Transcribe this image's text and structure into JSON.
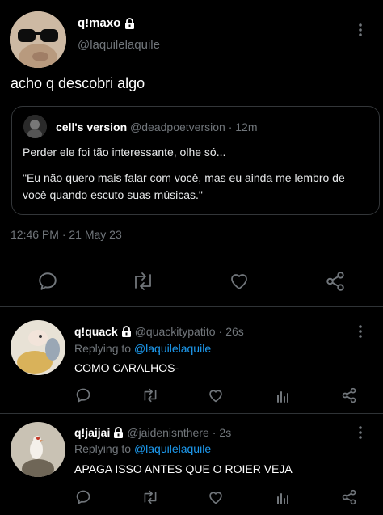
{
  "main_tweet": {
    "display_name": "q!maxo",
    "handle": "@laquilelaquile",
    "text": "acho q descobri algo",
    "quote": {
      "display_name": "cell's version",
      "handle": "@deadpoetversion",
      "sep": "·",
      "time": "12m",
      "line1": "Perder ele foi tão interessante, olhe só...",
      "line2": "\"Eu não quero mais falar com você, mas eu ainda me lembro de",
      "line3": "você quando escuto suas músicas.\""
    },
    "timestamp": "12:46 PM · 21 May 23"
  },
  "replies": [
    {
      "display_name": "q!quack",
      "handle": "@quackitypatito",
      "sep": "·",
      "time": "26s",
      "replying_prefix": "Replying to",
      "replying_to": "@laquilelaquile",
      "text": "COMO CARALHOS-"
    },
    {
      "display_name": "q!jaijai",
      "handle": "@jaidenisnthere",
      "sep": "·",
      "time": "2s",
      "replying_prefix": "Replying to",
      "replying_to": "@laquilelaquile",
      "text": "APAGA ISSO ANTES QUE O ROIER VEJA"
    }
  ],
  "colors": {
    "background": "#000000",
    "text": "#e7e9ea",
    "muted": "#71767b",
    "link": "#1d9bf0",
    "border": "#2f3336"
  }
}
